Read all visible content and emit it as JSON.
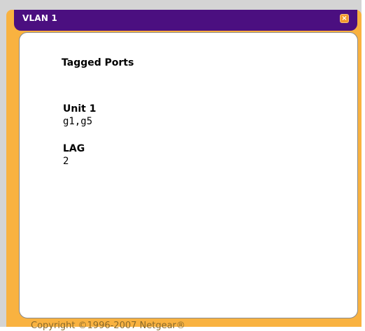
{
  "window": {
    "title": "VLAN 1",
    "close_label": "×"
  },
  "content": {
    "section_title": "Tagged Ports",
    "groups": [
      {
        "label": "Unit 1",
        "value": "g1,g5"
      },
      {
        "label": "LAG",
        "value": "2"
      }
    ]
  },
  "footer": {
    "copyright": "Copyright ©1996-2007 Netgear®"
  },
  "colors": {
    "title_bar": "#4b0f80",
    "panel": "#f9b240",
    "close_button": "#f39a2e"
  }
}
